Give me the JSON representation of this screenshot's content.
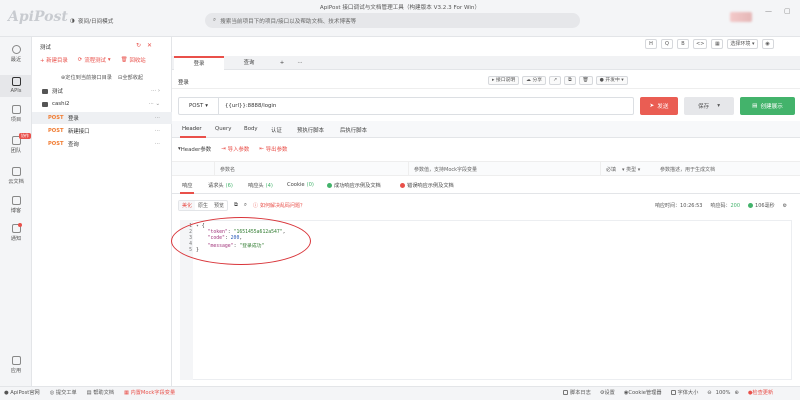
{
  "app": {
    "logo": "ApiPost",
    "dark_mode_label": "夜间/日间模式",
    "window_title": "ApiPost 接口调试与文档管理工具（构建版本 V3.2.3 For Win）",
    "search_placeholder": "搜索当前项目下的项目/接口以及帮助文档、技术博客等",
    "win_controls": [
      "—",
      "▢",
      "✕"
    ]
  },
  "rail": {
    "items": [
      {
        "label": "最近",
        "icon": "clock-icon"
      },
      {
        "label": "APIs",
        "icon": "api-icon"
      },
      {
        "label": "项目",
        "icon": "project-icon"
      },
      {
        "label": "团队",
        "icon": "team-icon",
        "badge": "协作"
      },
      {
        "label": "云文档",
        "icon": "cloud-icon"
      },
      {
        "label": "博客",
        "icon": "blog-icon"
      },
      {
        "label": "通知",
        "icon": "bell-icon"
      },
      {
        "label": "应用",
        "icon": "apps-icon"
      }
    ]
  },
  "tree": {
    "project_name": "测试",
    "refresh_icon": "↻",
    "close_icon": "✕",
    "new_dir": "+ 新建目录",
    "flow_test": "流程测试",
    "recycle": "回收站",
    "locate": "定位到当前接口目录",
    "collapse": "全部收起",
    "rows": [
      {
        "type": "folder",
        "label": "测试"
      },
      {
        "type": "folder",
        "label": "cashi2"
      },
      {
        "type": "api",
        "method": "POST",
        "label": "登录"
      },
      {
        "type": "api",
        "method": "POST",
        "label": "新建接口"
      },
      {
        "type": "api",
        "method": "POST",
        "label": "查询"
      }
    ]
  },
  "toolbar_icons": [
    "H",
    "Q",
    "B",
    "<>",
    "▦"
  ],
  "env": "选择环境",
  "tabs": [
    {
      "label": "登录"
    },
    {
      "label": "查询"
    },
    {
      "label": "+"
    },
    {
      "label": "···"
    }
  ],
  "request": {
    "name": "登录",
    "tools": [
      "接口说明",
      "分享",
      "↗",
      "⧉",
      "🗑",
      "开发中"
    ],
    "method": "POST",
    "url": "{{url}}:8888/login",
    "send": "发送",
    "save": "保存",
    "gen_docs": "创建展示"
  },
  "req_tabs": [
    "Header",
    "Query",
    "Body",
    "认证",
    "预执行脚本",
    "后执行脚本"
  ],
  "header_params": {
    "title": "Header参数",
    "import": "导入参数",
    "export": "导出参数",
    "columns": [
      "参数名",
      "参数值，支持Mock字段变量",
      "必填",
      "类型",
      "参数描述，用于生成文档"
    ]
  },
  "resp_tabs": [
    {
      "label": "响应"
    },
    {
      "label": "请求头",
      "count": "(6)"
    },
    {
      "label": "响应头",
      "count": "(4)"
    },
    {
      "label": "Cookie",
      "count": "(0)"
    },
    {
      "label": "成功响应示例及文档"
    },
    {
      "label": "错误响应示例及文档"
    }
  ],
  "resp_view": {
    "tabs": [
      "美化",
      "原生",
      "预览"
    ],
    "tip": "如何解决乱码问题？",
    "time_label": "响应时间：",
    "time": "10:26:53",
    "status_label": "响应码：",
    "status": "200",
    "duration": "106毫秒"
  },
  "response_lines": [
    {
      "ln": "1",
      "text": "{"
    },
    {
      "ln": "2",
      "key": "\"token\"",
      "val": "\"1651455a612a547\"",
      "kind": "s"
    },
    {
      "ln": "3",
      "key": "\"code\"",
      "val": "200",
      "kind": "n"
    },
    {
      "ln": "4",
      "key": "\"message\"",
      "val": "\"登录成功\"",
      "kind": "s"
    },
    {
      "ln": "5",
      "text": "}"
    }
  ],
  "status_bar": {
    "left": [
      "ApiPost官网",
      "提交工单",
      "帮助文档",
      "内置Mock字段变量"
    ],
    "right": [
      "脚本日志",
      "设置",
      "Cookie管理器",
      "字体大小",
      "100%",
      "检查更新"
    ]
  },
  "colors": {
    "accent": "#e9504a",
    "green": "#43b36b",
    "post": "#f07a2f"
  }
}
